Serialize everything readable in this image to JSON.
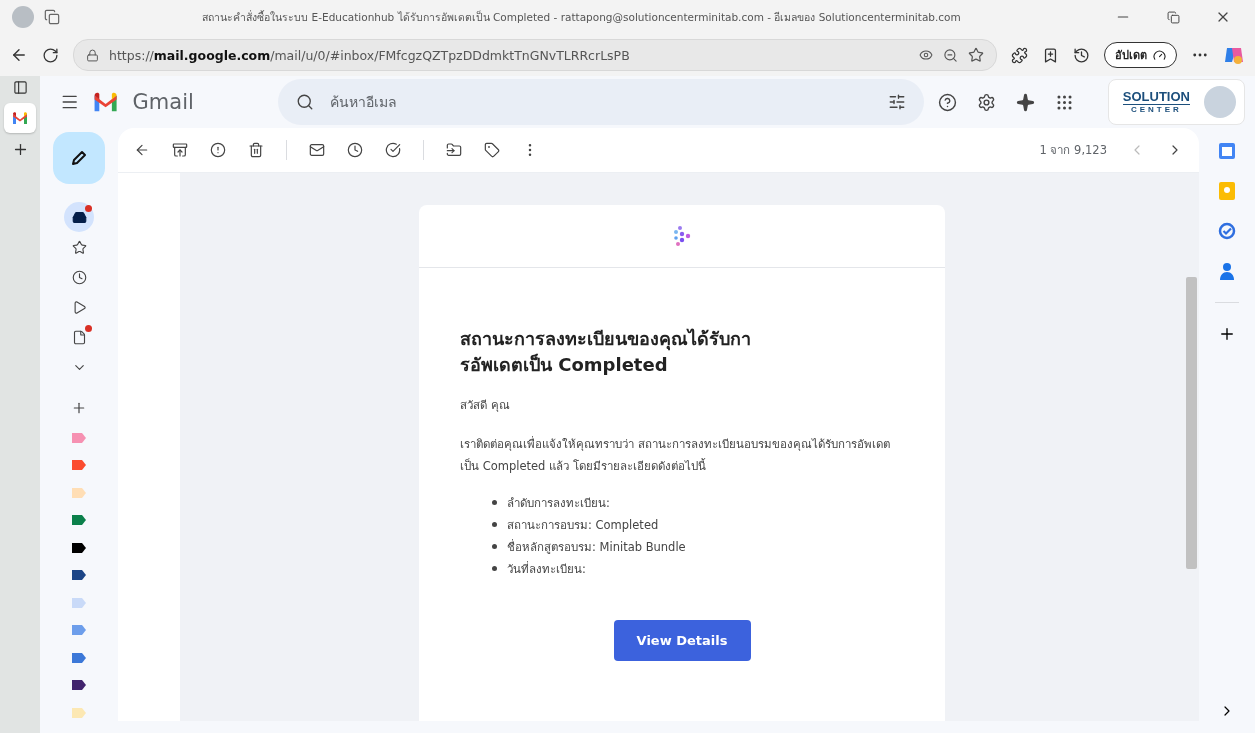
{
  "browser": {
    "title": "สถานะคำสั่งซื้อในระบบ E-Educationhub ได้รับการอัพเดตเป็น Completed - rattapong@solutioncenterminitab.com - อีเมลของ Solutioncenterminitab.com",
    "url": "https://**mail.google.com**/mail/u/0/#inbox/FMfcgzQZTpzDDdmktTnGNvTLRRcrLsPB",
    "update_button": "อัปเดต",
    "tabs": [
      {
        "kind": "gmail",
        "selected": true
      }
    ]
  },
  "gmail": {
    "product": "Gmail",
    "search_placeholder": "ค้นหาอีเมล",
    "brand_line1": "SOLUTION",
    "brand_line2": "CENTER"
  },
  "nav": [
    {
      "kind": "inbox",
      "selected": true,
      "badge": true
    },
    {
      "kind": "starred",
      "selected": false,
      "badge": false
    },
    {
      "kind": "snoozed",
      "selected": false,
      "badge": false
    },
    {
      "kind": "sent",
      "selected": false,
      "badge": false
    },
    {
      "kind": "drafts",
      "selected": false,
      "badge": true
    },
    {
      "kind": "more",
      "selected": false,
      "badge": false
    }
  ],
  "labels": [
    {
      "color": "#f691b2"
    },
    {
      "color": "#fb4c2f"
    },
    {
      "color": "#ffdeb5"
    },
    {
      "color": "#0b804b"
    },
    {
      "color": "#000000"
    },
    {
      "color": "#1c4587"
    },
    {
      "color": "#c9daf8"
    },
    {
      "color": "#6d9eeb"
    },
    {
      "color": "#3c78d8"
    },
    {
      "color": "#41236d"
    },
    {
      "color": "#fce8b3"
    }
  ],
  "toolbar": {
    "counter": "1 จาก 9,123"
  },
  "email": {
    "heading": [
      "สถานะการลงทะเบียนของคุณได้รับกา",
      "รอัพเดตเป็น Completed"
    ],
    "greeting": "สวัสดี คุณ",
    "body": "เราติดต่อคุณเพื่อแจ้งให้คุณทราบว่า สถานะการลงทะเบียนอบรมของคุณได้รับการอัพเดตเป็น Completed แล้ว โดยมีรายละเอียดดังต่อไปนี้",
    "details": [
      "ลำดับการลงทะเบียน:",
      "สถานะการอบรม: Completed",
      "ชื่อหลักสูตรอบรม: Minitab Bundle",
      "วันที่ลงทะเบียน:"
    ],
    "button": "View Details"
  }
}
